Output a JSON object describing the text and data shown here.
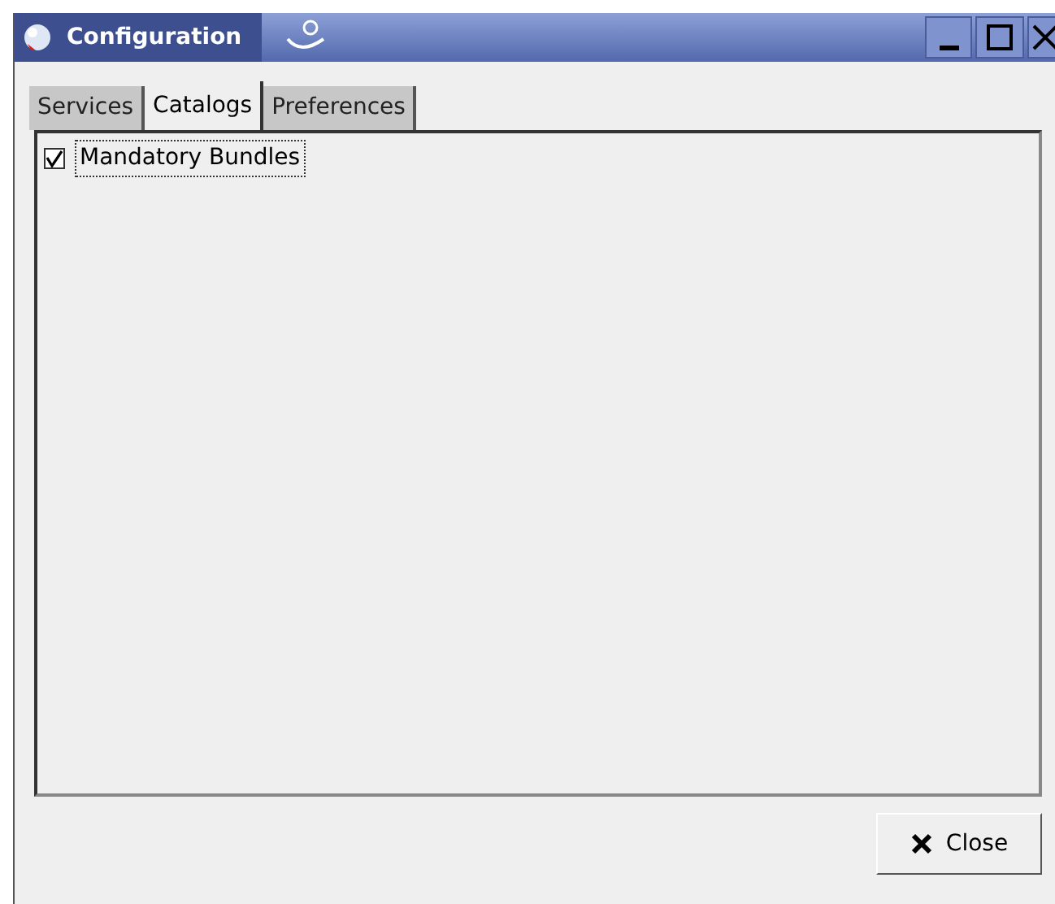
{
  "window": {
    "title": "Configuration"
  },
  "tabs": [
    {
      "label": "Services",
      "selected": false
    },
    {
      "label": "Catalogs",
      "selected": true
    },
    {
      "label": "Preferences",
      "selected": false
    }
  ],
  "catalogs": [
    {
      "label": "Mandatory Bundles",
      "checked": true
    }
  ],
  "buttons": [
    {
      "label": "Close"
    }
  ]
}
